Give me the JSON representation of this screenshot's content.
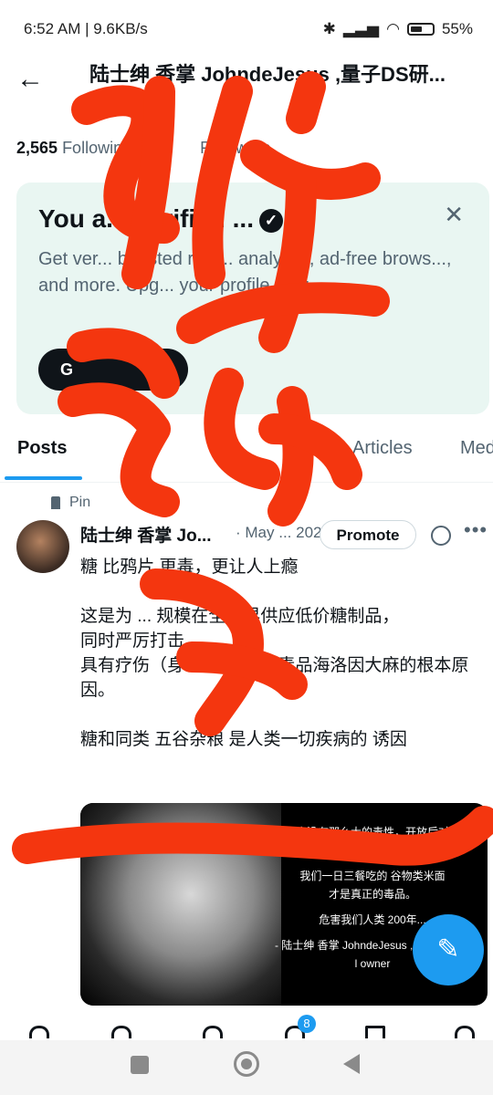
{
  "status_bar": {
    "left": "6:52 AM | 9.6KB/s",
    "battery": "55%",
    "battery_fraction": 0.55
  },
  "header": {
    "back_icon": "arrow-left-icon",
    "title": "陆士绅 香掌 JohndeJesus ,量子DS研..."
  },
  "profile": {
    "following_count": "2,565",
    "following_label": "Following",
    "followers_label": "Followers"
  },
  "verify_card": {
    "title": "You a... verified ...",
    "body": "Get ver... boosted repl... analytics, ad-free brows..., and more. Upg... your profile now.",
    "button": "G"
  },
  "tabs": [
    {
      "label": "Posts",
      "active": true
    },
    {
      "label": "Articles",
      "active": false
    },
    {
      "label": "Med",
      "active": false
    }
  ],
  "post": {
    "pinned_label": "Pin",
    "author": "陆士绅 香掌 Jo...",
    "date": "· May ... 2022",
    "promote": "Promote",
    "text_lines": [
      "糖 比鸦片 更毒，更让人上瘾",
      "",
      "这是为 ... 规模在全世界供应低价糖制品，",
      "同时严厉打击",
      "具有疗伤（身理 ）... 果的毒品海洛因大麻的根本原因。",
      "",
      "糖和同类 五谷杂粮 是人类一切疾病的 诱因"
    ],
    "media_lines": [
      "大麻没有那么大的毒性，开放后对社",
      "吸烟的危害远大于大麻。",
      "我们一日三餐吃的 谷物类米面",
      "才是真正的毒品。",
      "危害我们人类 200年...",
      "- 陆士绅 香掌 JohndeJesus ,量子DS研...",
      "l owner"
    ]
  },
  "bottom_nav": {
    "badge": "8"
  },
  "colors": {
    "accent": "#1d9bf0",
    "scribble": "#f4360f",
    "card_bg": "#e9f6f2"
  }
}
